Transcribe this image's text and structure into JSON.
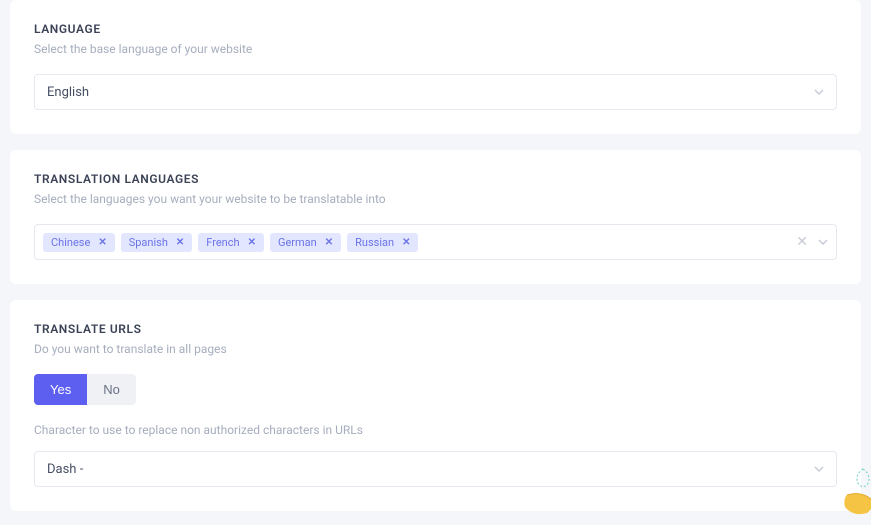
{
  "language": {
    "title": "LANGUAGE",
    "desc": "Select the base language of your website",
    "selected": "English"
  },
  "translation": {
    "title": "TRANSLATION LANGUAGES",
    "desc": "Select the languages you want your website to be translatable into",
    "tags": [
      "Chinese",
      "Spanish",
      "French",
      "German",
      "Russian"
    ]
  },
  "urls": {
    "title": "TRANSLATE URLS",
    "desc1": "Do you want to translate in all pages",
    "yes": "Yes",
    "no": "No",
    "desc2": "Character to use to replace non authorized characters in URLs",
    "selected": "Dash -"
  }
}
